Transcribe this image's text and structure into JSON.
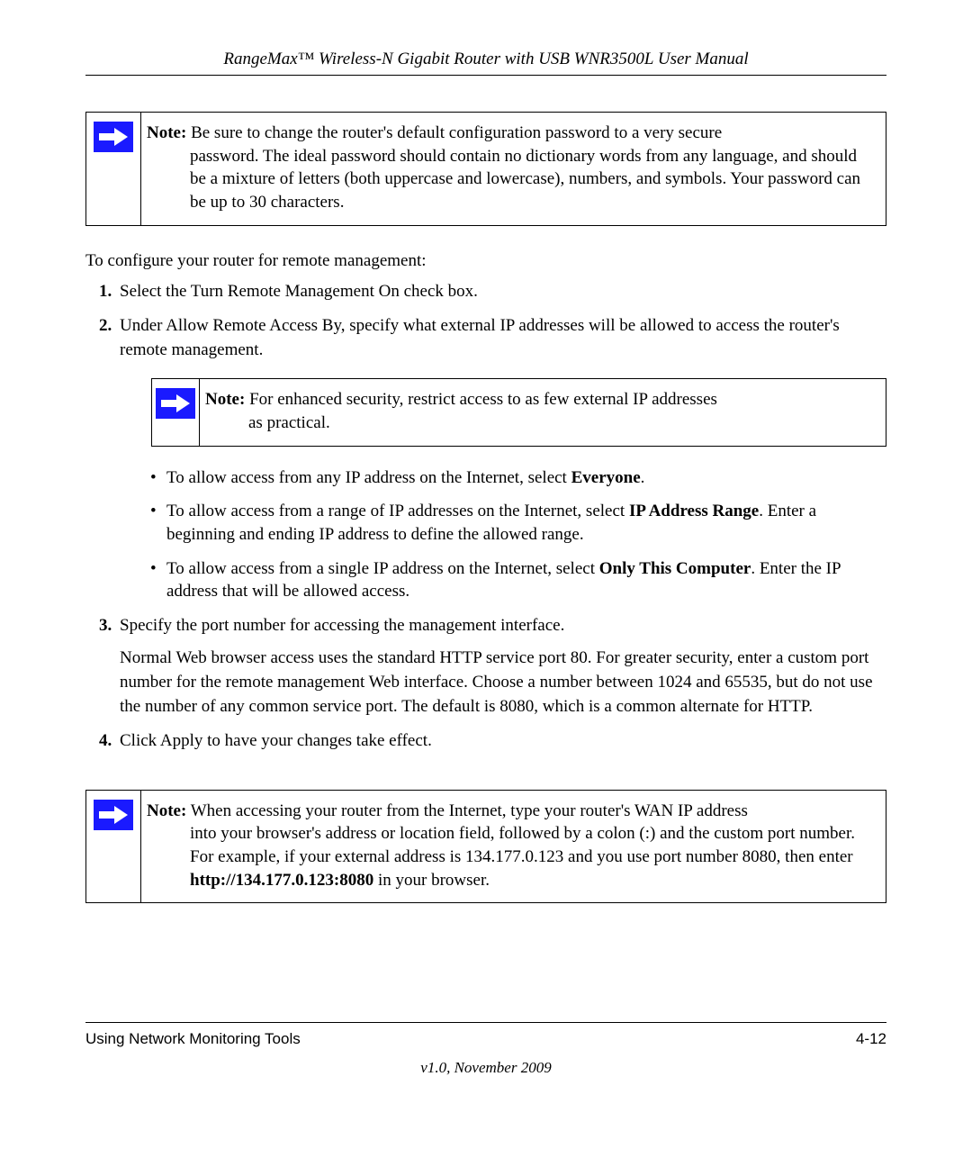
{
  "header": {
    "title": "RangeMax™ Wireless-N Gigabit Router with USB WNR3500L User Manual"
  },
  "note1": {
    "label": "Note:",
    "text_first": " Be sure to change the router's default configuration password to a very secure",
    "text_rest": "password. The ideal password should contain no dictionary words from any language, and should be a mixture of letters (both uppercase and lowercase), numbers, and symbols. Your password can be up to 30 characters."
  },
  "intro": "To configure your router for remote management:",
  "steps": {
    "s1_pre": "Select the ",
    "s1_bold": "Turn Remote Management On",
    "s1_post": " check box.",
    "s2": "Under Allow Remote Access By, specify what external IP addresses will be allowed to access the router's remote management.",
    "s3": "Specify the port number for accessing the management interface.",
    "s3_body": "Normal Web browser access uses the standard HTTP service port 80. For greater security, enter a custom port number for the remote management Web interface. Choose a number between 1024 and 65535, but do not use the number of any common service port. The default is 8080, which is a common alternate for HTTP.",
    "s4_pre": "Click ",
    "s4_bold": "Apply",
    "s4_post": " to have your changes take effect."
  },
  "note2": {
    "label": "Note:",
    "text_first": " For enhanced security, restrict access to as few external IP addresses",
    "text_rest": "as practical."
  },
  "bullets": {
    "b1_pre": "To allow access from any IP address on the Internet, select ",
    "b1_bold": "Everyone",
    "b1_post": ".",
    "b2_pre": "To allow access from a range of IP addresses on the Internet, select ",
    "b2_bold": "IP Address Range",
    "b2_post": ". Enter a beginning and ending IP address to define the allowed range.",
    "b3_pre": "To allow access from a single IP address on the Internet, select ",
    "b3_bold": "Only This Computer",
    "b3_post": ". Enter the IP address that will be allowed access."
  },
  "note3": {
    "label": "Note:",
    "text_first": " When accessing your router from the Internet, type your router's WAN IP address",
    "text_rest_a": "into your browser's address or location field, followed by a colon (:) and the custom port number. For example, if your external address is 134.177.0.123 and you use port number 8080, then enter ",
    "text_rest_bold": "http://134.177.0.123:8080",
    "text_rest_b": " in your browser."
  },
  "footer": {
    "section": "Using Network Monitoring Tools",
    "page": "4-12",
    "version": "v1.0, November 2009"
  }
}
